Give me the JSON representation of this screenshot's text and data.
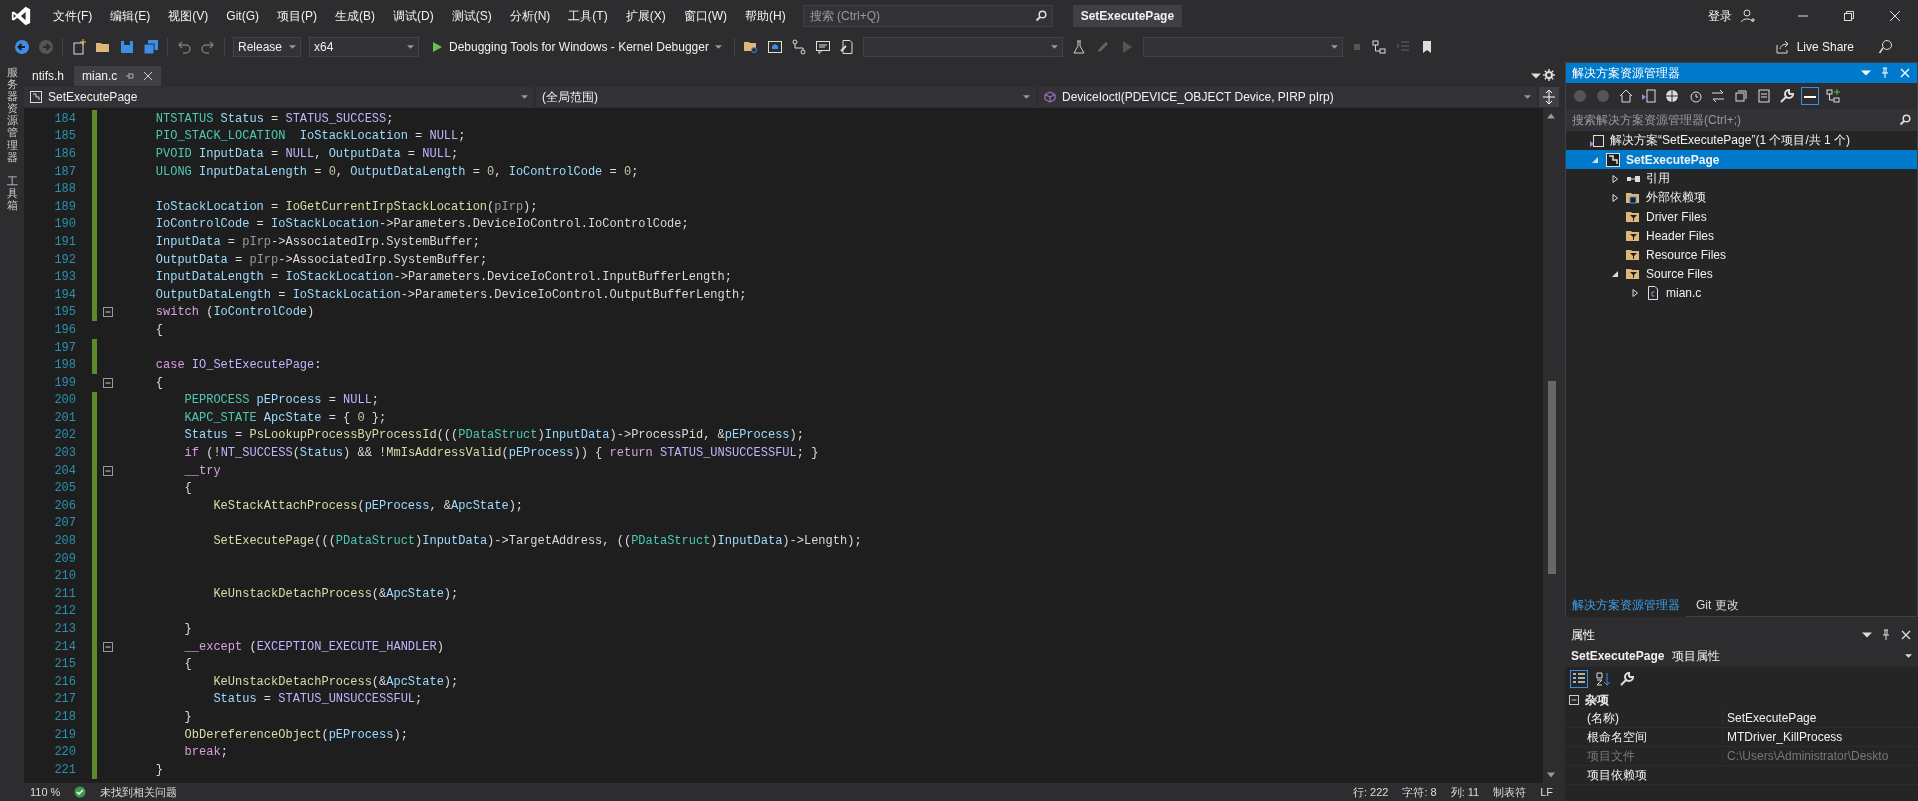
{
  "menu_bar": {
    "items": [
      "文件(F)",
      "编辑(E)",
      "视图(V)",
      "Git(G)",
      "项目(P)",
      "生成(B)",
      "调试(D)",
      "测试(S)",
      "分析(N)",
      "工具(T)",
      "扩展(X)",
      "窗口(W)",
      "帮助(H)"
    ],
    "search": {
      "placeholder": "搜索 (Ctrl+Q)"
    },
    "solution_title": "SetExecutePage",
    "sign_in": "登录"
  },
  "toolbar": {
    "configuration": "Release",
    "platform": "x64",
    "debugger": "Debugging Tools for Windows - Kernel Debugger",
    "live_share": "Live Share"
  },
  "side_strip": [
    "服务器资源管理器",
    "工具箱"
  ],
  "tabs": [
    {
      "label": "ntifs.h",
      "selected": false
    },
    {
      "label": "mian.c",
      "selected": true
    }
  ],
  "nav_bar": {
    "project": "SetExecutePage",
    "scope": "(全局范围)",
    "function": "DeviceIoctl(PDEVICE_OBJECT Device, PIRP pIrp)"
  },
  "code": {
    "lines": [
      {
        "number": "184",
        "changed": true,
        "fold": false,
        "tokens": [
          {
            "text": "    NTSTATUS",
            "kind": "type"
          },
          {
            "text": " Status",
            "kind": "var"
          },
          {
            "text": " = ",
            "kind": "plain"
          },
          {
            "text": "STATUS_SUCCESS",
            "kind": "macro"
          },
          {
            "text": ";",
            "kind": "plain"
          }
        ]
      },
      {
        "number": "185",
        "changed": true,
        "fold": false,
        "tokens": [
          {
            "text": "    PIO_STACK_LOCATION",
            "kind": "type"
          },
          {
            "text": "  IoStackLocation",
            "kind": "var"
          },
          {
            "text": " = ",
            "kind": "plain"
          },
          {
            "text": "NULL",
            "kind": "macro"
          },
          {
            "text": ";",
            "kind": "plain"
          }
        ]
      },
      {
        "number": "186",
        "changed": true,
        "fold": false,
        "tokens": [
          {
            "text": "    PVOID",
            "kind": "type"
          },
          {
            "text": " InputData",
            "kind": "var"
          },
          {
            "text": " = ",
            "kind": "plain"
          },
          {
            "text": "NULL",
            "kind": "macro"
          },
          {
            "text": ", ",
            "kind": "plain"
          },
          {
            "text": "OutputData",
            "kind": "var"
          },
          {
            "text": " = ",
            "kind": "plain"
          },
          {
            "text": "NULL",
            "kind": "macro"
          },
          {
            "text": ";",
            "kind": "plain"
          }
        ]
      },
      {
        "number": "187",
        "changed": true,
        "fold": false,
        "tokens": [
          {
            "text": "    ULONG",
            "kind": "type"
          },
          {
            "text": " InputDataLength",
            "kind": "var"
          },
          {
            "text": " = ",
            "kind": "plain"
          },
          {
            "text": "0",
            "kind": "num"
          },
          {
            "text": ", ",
            "kind": "plain"
          },
          {
            "text": "OutputDataLength",
            "kind": "var"
          },
          {
            "text": " = ",
            "kind": "plain"
          },
          {
            "text": "0",
            "kind": "num"
          },
          {
            "text": ", ",
            "kind": "plain"
          },
          {
            "text": "IoControlCode",
            "kind": "var"
          },
          {
            "text": " = ",
            "kind": "plain"
          },
          {
            "text": "0",
            "kind": "num"
          },
          {
            "text": ";",
            "kind": "plain"
          }
        ]
      },
      {
        "number": "188",
        "changed": true,
        "fold": false
      },
      {
        "number": "189",
        "changed": true,
        "fold": false,
        "tokens": [
          {
            "text": "    IoStackLocation",
            "kind": "var"
          },
          {
            "text": " = ",
            "kind": "plain"
          },
          {
            "text": "IoGetCurrentIrpStackLocation",
            "kind": "func"
          },
          {
            "text": "(",
            "kind": "plain"
          },
          {
            "text": "pIrp",
            "kind": "param"
          },
          {
            "text": ");",
            "kind": "plain"
          }
        ]
      },
      {
        "number": "190",
        "changed": true,
        "fold": false,
        "tokens": [
          {
            "text": "    IoControlCode",
            "kind": "var"
          },
          {
            "text": " = ",
            "kind": "plain"
          },
          {
            "text": "IoStackLocation",
            "kind": "var"
          },
          {
            "text": "->",
            "kind": "plain"
          },
          {
            "text": "Parameters.DeviceIoControl.IoControlCode",
            "kind": "member"
          },
          {
            "text": ";",
            "kind": "plain"
          }
        ]
      },
      {
        "number": "191",
        "changed": true,
        "fold": false,
        "tokens": [
          {
            "text": "    InputData",
            "kind": "var"
          },
          {
            "text": " = ",
            "kind": "plain"
          },
          {
            "text": "pIrp",
            "kind": "param"
          },
          {
            "text": "->",
            "kind": "plain"
          },
          {
            "text": "AssociatedIrp.SystemBuffer",
            "kind": "member"
          },
          {
            "text": ";",
            "kind": "plain"
          }
        ]
      },
      {
        "number": "192",
        "changed": true,
        "fold": false,
        "tokens": [
          {
            "text": "    OutputData",
            "kind": "var"
          },
          {
            "text": " = ",
            "kind": "plain"
          },
          {
            "text": "pIrp",
            "kind": "param"
          },
          {
            "text": "->",
            "kind": "plain"
          },
          {
            "text": "AssociatedIrp.SystemBuffer",
            "kind": "member"
          },
          {
            "text": ";",
            "kind": "plain"
          }
        ]
      },
      {
        "number": "193",
        "changed": true,
        "fold": false,
        "tokens": [
          {
            "text": "    InputDataLength",
            "kind": "var"
          },
          {
            "text": " = ",
            "kind": "plain"
          },
          {
            "text": "IoStackLocation",
            "kind": "var"
          },
          {
            "text": "->",
            "kind": "plain"
          },
          {
            "text": "Parameters.DeviceIoControl.InputBufferLength",
            "kind": "member"
          },
          {
            "text": ";",
            "kind": "plain"
          }
        ]
      },
      {
        "number": "194",
        "changed": true,
        "fold": false,
        "tokens": [
          {
            "text": "    OutputDataLength",
            "kind": "var"
          },
          {
            "text": " = ",
            "kind": "plain"
          },
          {
            "text": "IoStackLocation",
            "kind": "var"
          },
          {
            "text": "->",
            "kind": "plain"
          },
          {
            "text": "Parameters.DeviceIoControl.OutputBufferLength",
            "kind": "member"
          },
          {
            "text": ";",
            "kind": "plain"
          }
        ]
      },
      {
        "number": "195",
        "changed": true,
        "fold": true,
        "tokens": [
          {
            "text": "    switch",
            "kind": "keyword"
          },
          {
            "text": " (",
            "kind": "plain"
          },
          {
            "text": "IoControlCode",
            "kind": "var"
          },
          {
            "text": ")",
            "kind": "plain"
          }
        ]
      },
      {
        "number": "196",
        "changed": false,
        "fold": false,
        "tokens": [
          {
            "text": "    {",
            "kind": "plain"
          }
        ]
      },
      {
        "number": "197",
        "changed": true,
        "fold": false
      },
      {
        "number": "198",
        "changed": true,
        "fold": false,
        "tokens": [
          {
            "text": "    case",
            "kind": "keyword"
          },
          {
            "text": " IO_SetExecutePage",
            "kind": "macro"
          },
          {
            "text": ":",
            "kind": "plain"
          }
        ]
      },
      {
        "number": "199",
        "changed": false,
        "fold": true,
        "tokens": [
          {
            "text": "    {",
            "kind": "plain"
          }
        ]
      },
      {
        "number": "200",
        "changed": true,
        "fold": false,
        "tokens": [
          {
            "text": "        PEPROCESS",
            "kind": "type"
          },
          {
            "text": " pEProcess",
            "kind": "var"
          },
          {
            "text": " = ",
            "kind": "plain"
          },
          {
            "text": "NULL",
            "kind": "macro"
          },
          {
            "text": ";",
            "kind": "plain"
          }
        ]
      },
      {
        "number": "201",
        "changed": true,
        "fold": false,
        "tokens": [
          {
            "text": "        KAPC_STATE",
            "kind": "type"
          },
          {
            "text": " ApcState",
            "kind": "var"
          },
          {
            "text": " = { ",
            "kind": "plain"
          },
          {
            "text": "0",
            "kind": "num"
          },
          {
            "text": " };",
            "kind": "plain"
          }
        ]
      },
      {
        "number": "202",
        "changed": true,
        "fold": false,
        "tokens": [
          {
            "text": "        Status",
            "kind": "var"
          },
          {
            "text": " = ",
            "kind": "plain"
          },
          {
            "text": "PsLookupProcessByProcessId",
            "kind": "func"
          },
          {
            "text": "(((",
            "kind": "plain"
          },
          {
            "text": "PDataStruct",
            "kind": "type"
          },
          {
            "text": ")",
            "kind": "plain"
          },
          {
            "text": "InputData",
            "kind": "var"
          },
          {
            "text": ")->",
            "kind": "plain"
          },
          {
            "text": "ProcessPid",
            "kind": "member"
          },
          {
            "text": ", &",
            "kind": "plain"
          },
          {
            "text": "pEProcess",
            "kind": "var"
          },
          {
            "text": ");",
            "kind": "plain"
          }
        ]
      },
      {
        "number": "203",
        "changed": true,
        "fold": false,
        "tokens": [
          {
            "text": "        if",
            "kind": "keyword"
          },
          {
            "text": " (!",
            "kind": "plain"
          },
          {
            "text": "NT_SUCCESS",
            "kind": "macro"
          },
          {
            "text": "(",
            "kind": "plain"
          },
          {
            "text": "Status",
            "kind": "var"
          },
          {
            "text": ") && !",
            "kind": "plain"
          },
          {
            "text": "MmIsAddressValid",
            "kind": "func"
          },
          {
            "text": "(",
            "kind": "plain"
          },
          {
            "text": "pEProcess",
            "kind": "var"
          },
          {
            "text": ")) { ",
            "kind": "plain"
          },
          {
            "text": "return",
            "kind": "keyword"
          },
          {
            "text": " STATUS_UNSUCCESSFUL",
            "kind": "macro"
          },
          {
            "text": "; }",
            "kind": "plain"
          }
        ]
      },
      {
        "number": "204",
        "changed": true,
        "fold": true,
        "tokens": [
          {
            "text": "        __try",
            "kind": "keyword"
          }
        ]
      },
      {
        "number": "205",
        "changed": true,
        "fold": false,
        "tokens": [
          {
            "text": "        {",
            "kind": "plain"
          }
        ]
      },
      {
        "number": "206",
        "changed": true,
        "fold": false,
        "tokens": [
          {
            "text": "            KeStackAttachProcess",
            "kind": "func"
          },
          {
            "text": "(",
            "kind": "plain"
          },
          {
            "text": "pEProcess",
            "kind": "var"
          },
          {
            "text": ", &",
            "kind": "plain"
          },
          {
            "text": "ApcState",
            "kind": "var"
          },
          {
            "text": ");",
            "kind": "plain"
          }
        ]
      },
      {
        "number": "207",
        "changed": true,
        "fold": false
      },
      {
        "number": "208",
        "changed": true,
        "fold": false,
        "tokens": [
          {
            "text": "            SetExecutePage",
            "kind": "func"
          },
          {
            "text": "(((",
            "kind": "plain"
          },
          {
            "text": "PDataStruct",
            "kind": "type"
          },
          {
            "text": ")",
            "kind": "plain"
          },
          {
            "text": "InputData",
            "kind": "var"
          },
          {
            "text": ")->",
            "kind": "plain"
          },
          {
            "text": "TargetAddress",
            "kind": "member"
          },
          {
            "text": ", ((",
            "kind": "plain"
          },
          {
            "text": "PDataStruct",
            "kind": "type"
          },
          {
            "text": ")",
            "kind": "plain"
          },
          {
            "text": "InputData",
            "kind": "var"
          },
          {
            "text": ")->",
            "kind": "plain"
          },
          {
            "text": "Length",
            "kind": "member"
          },
          {
            "text": ");",
            "kind": "plain"
          }
        ]
      },
      {
        "number": "209",
        "changed": true,
        "fold": false
      },
      {
        "number": "210",
        "changed": true,
        "fold": false
      },
      {
        "number": "211",
        "changed": true,
        "fold": false,
        "tokens": [
          {
            "text": "            KeUnstackDetachProcess",
            "kind": "func"
          },
          {
            "text": "(&",
            "kind": "plain"
          },
          {
            "text": "ApcState",
            "kind": "var"
          },
          {
            "text": ");",
            "kind": "plain"
          }
        ]
      },
      {
        "number": "212",
        "changed": true,
        "fold": false
      },
      {
        "number": "213",
        "changed": true,
        "fold": false,
        "tokens": [
          {
            "text": "        }",
            "kind": "plain"
          }
        ]
      },
      {
        "number": "214",
        "changed": true,
        "fold": true,
        "tokens": [
          {
            "text": "        __except",
            "kind": "keyword"
          },
          {
            "text": " (",
            "kind": "plain"
          },
          {
            "text": "EXCEPTION_EXECUTE_HANDLER",
            "kind": "macro"
          },
          {
            "text": ")",
            "kind": "plain"
          }
        ]
      },
      {
        "number": "215",
        "changed": true,
        "fold": false,
        "tokens": [
          {
            "text": "        {",
            "kind": "plain"
          }
        ]
      },
      {
        "number": "216",
        "changed": true,
        "fold": false,
        "tokens": [
          {
            "text": "            KeUnstackDetachProcess",
            "kind": "func"
          },
          {
            "text": "(&",
            "kind": "plain"
          },
          {
            "text": "ApcState",
            "kind": "var"
          },
          {
            "text": ");",
            "kind": "plain"
          }
        ]
      },
      {
        "number": "217",
        "changed": true,
        "fold": false,
        "tokens": [
          {
            "text": "            Status",
            "kind": "var"
          },
          {
            "text": " = ",
            "kind": "plain"
          },
          {
            "text": "STATUS_UNSUCCESSFUL",
            "kind": "macro"
          },
          {
            "text": ";",
            "kind": "plain"
          }
        ]
      },
      {
        "number": "218",
        "changed": true,
        "fold": false,
        "tokens": [
          {
            "text": "        }",
            "kind": "plain"
          }
        ]
      },
      {
        "number": "219",
        "changed": true,
        "fold": false,
        "tokens": [
          {
            "text": "        ObDereferenceObject",
            "kind": "func"
          },
          {
            "text": "(",
            "kind": "plain"
          },
          {
            "text": "pEProcess",
            "kind": "var"
          },
          {
            "text": ");",
            "kind": "plain"
          }
        ]
      },
      {
        "number": "220",
        "changed": true,
        "fold": false,
        "tokens": [
          {
            "text": "        break",
            "kind": "keyword"
          },
          {
            "text": ";",
            "kind": "plain"
          }
        ]
      },
      {
        "number": "221",
        "changed": true,
        "fold": false,
        "tokens": [
          {
            "text": "    }",
            "kind": "plain"
          }
        ]
      }
    ]
  },
  "editor_status": {
    "zoom": "110 %",
    "issues": "未找到相关问题",
    "line": "行: 222",
    "char": "字符: 8",
    "column": "列: 11",
    "indent": "制表符",
    "line_ending": "LF"
  },
  "solution_explorer": {
    "title": "解决方案资源管理器",
    "search": {
      "placeholder": "搜索解决方案资源管理器(Ctrl+;)"
    },
    "tree": [
      {
        "label": "解决方案“SetExecutePage”(1 个项目/共 1 个)",
        "kind": "solution",
        "selected": false,
        "children": [
          {
            "label": "SetExecutePage",
            "kind": "project",
            "selected": true,
            "expanded": true,
            "children": [
              {
                "label": "引用",
                "kind": "references",
                "selected": false,
                "expanded": false
              },
              {
                "label": "外部依赖项",
                "kind": "external",
                "selected": false,
                "expanded": false
              },
              {
                "label": "Driver Files",
                "kind": "filter",
                "selected": false
              },
              {
                "label": "Header Files",
                "kind": "filter",
                "selected": false
              },
              {
                "label": "Resource Files",
                "kind": "filter",
                "selected": false
              },
              {
                "label": "Source Files",
                "kind": "filter",
                "selected": false,
                "expanded": true,
                "children": [
                  {
                    "label": "mian.c",
                    "kind": "file",
                    "selected": false,
                    "expanded": false
                  }
                ]
              }
            ]
          }
        ]
      }
    ],
    "tabs": [
      {
        "label": "解决方案资源管理器",
        "selected": true
      },
      {
        "label": "Git 更改",
        "selected": false
      }
    ]
  },
  "properties": {
    "title": "属性",
    "object": "SetExecutePage",
    "object_type": "项目属性",
    "category": "杂项",
    "rows": [
      {
        "name": "(名称)",
        "value": "SetExecutePage",
        "disabled": false
      },
      {
        "name": "根命名空间",
        "value": "MTDriver_KillProcess",
        "disabled": false
      },
      {
        "name": "项目文件",
        "value": "C:\\Users\\Administrator\\Deskto",
        "disabled": true
      },
      {
        "name": "项目依赖项",
        "disabled": false
      }
    ]
  }
}
